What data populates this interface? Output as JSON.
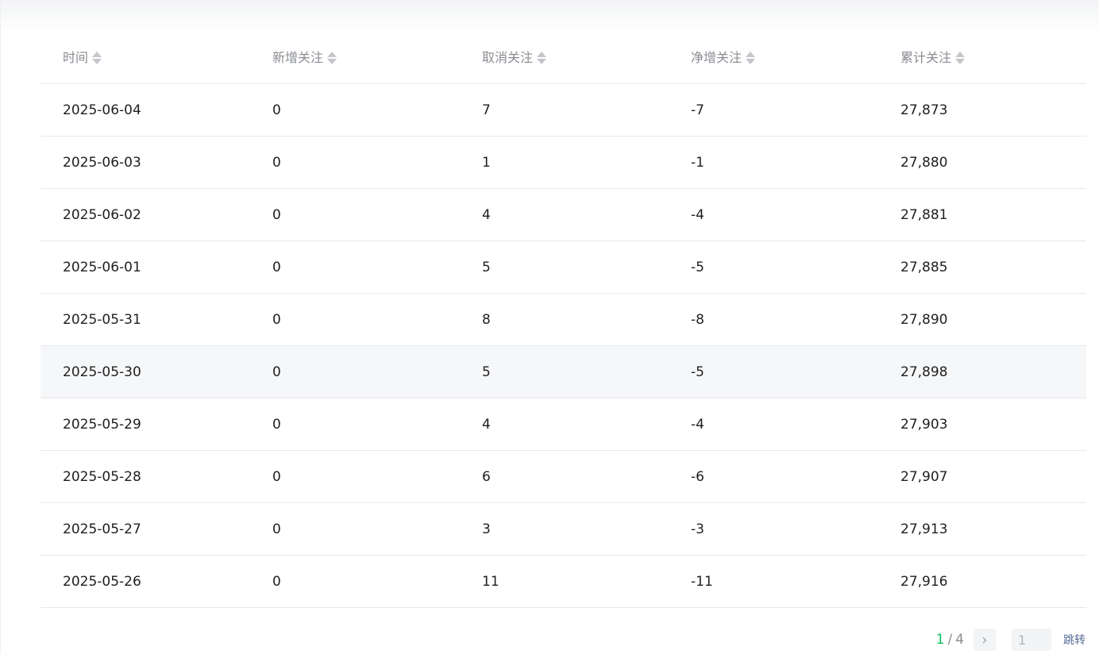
{
  "table": {
    "headers": [
      "时间",
      "新增关注",
      "取消关注",
      "净增关注",
      "累计关注"
    ],
    "rows": [
      [
        "2025-06-04",
        "0",
        "7",
        "-7",
        "27,873"
      ],
      [
        "2025-06-03",
        "0",
        "1",
        "-1",
        "27,880"
      ],
      [
        "2025-06-02",
        "0",
        "4",
        "-4",
        "27,881"
      ],
      [
        "2025-06-01",
        "0",
        "5",
        "-5",
        "27,885"
      ],
      [
        "2025-05-31",
        "0",
        "8",
        "-8",
        "27,890"
      ],
      [
        "2025-05-30",
        "0",
        "5",
        "-5",
        "27,898"
      ],
      [
        "2025-05-29",
        "0",
        "4",
        "-4",
        "27,903"
      ],
      [
        "2025-05-28",
        "0",
        "6",
        "-6",
        "27,907"
      ],
      [
        "2025-05-27",
        "0",
        "3",
        "-3",
        "27,913"
      ],
      [
        "2025-05-26",
        "0",
        "11",
        "-11",
        "27,916"
      ]
    ]
  },
  "pagination": {
    "current": "1",
    "separator": "/",
    "total": "4",
    "next_icon": "chevron-right-icon",
    "next_glyph": "›",
    "jump_placeholder": "1",
    "jump_label": "跳转"
  },
  "colors": {
    "accent": "#07c160",
    "link": "#576b95",
    "header_text": "#8a8d93",
    "row_hover": "#f6f7f9"
  }
}
